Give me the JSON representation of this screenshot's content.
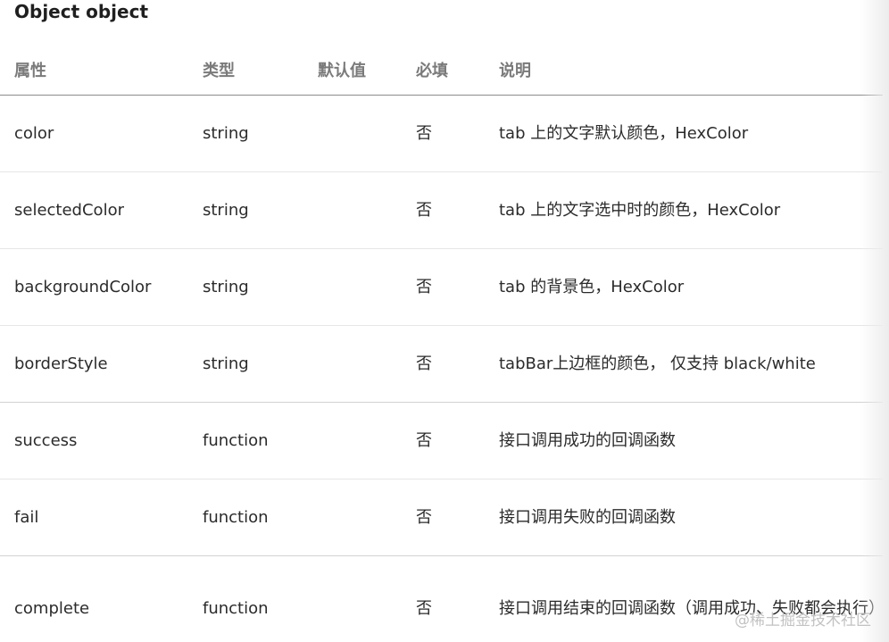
{
  "title": "Object object",
  "table": {
    "headers": {
      "prop": "属性",
      "type": "类型",
      "default": "默认值",
      "required": "必填",
      "desc": "说明"
    },
    "rows": [
      {
        "prop": "color",
        "type": "string",
        "default": "",
        "required": "否",
        "desc": "tab 上的文字默认颜色，HexColor"
      },
      {
        "prop": "selectedColor",
        "type": "string",
        "default": "",
        "required": "否",
        "desc": "tab 上的文字选中时的颜色，HexColor"
      },
      {
        "prop": "backgroundColor",
        "type": "string",
        "default": "",
        "required": "否",
        "desc": "tab 的背景色，HexColor"
      },
      {
        "prop": "borderStyle",
        "type": "string",
        "default": "",
        "required": "否",
        "desc": "tabBar上边框的颜色， 仅支持 black/white"
      },
      {
        "prop": "success",
        "type": "function",
        "default": "",
        "required": "否",
        "desc": "接口调用成功的回调函数"
      },
      {
        "prop": "fail",
        "type": "function",
        "default": "",
        "required": "否",
        "desc": "接口调用失败的回调函数"
      },
      {
        "prop": "complete",
        "type": "function",
        "default": "",
        "required": "否",
        "desc": "接口调用结束的回调函数（调用成功、失败都会执行）"
      }
    ]
  },
  "watermark": "@稀土掘金技术社区"
}
